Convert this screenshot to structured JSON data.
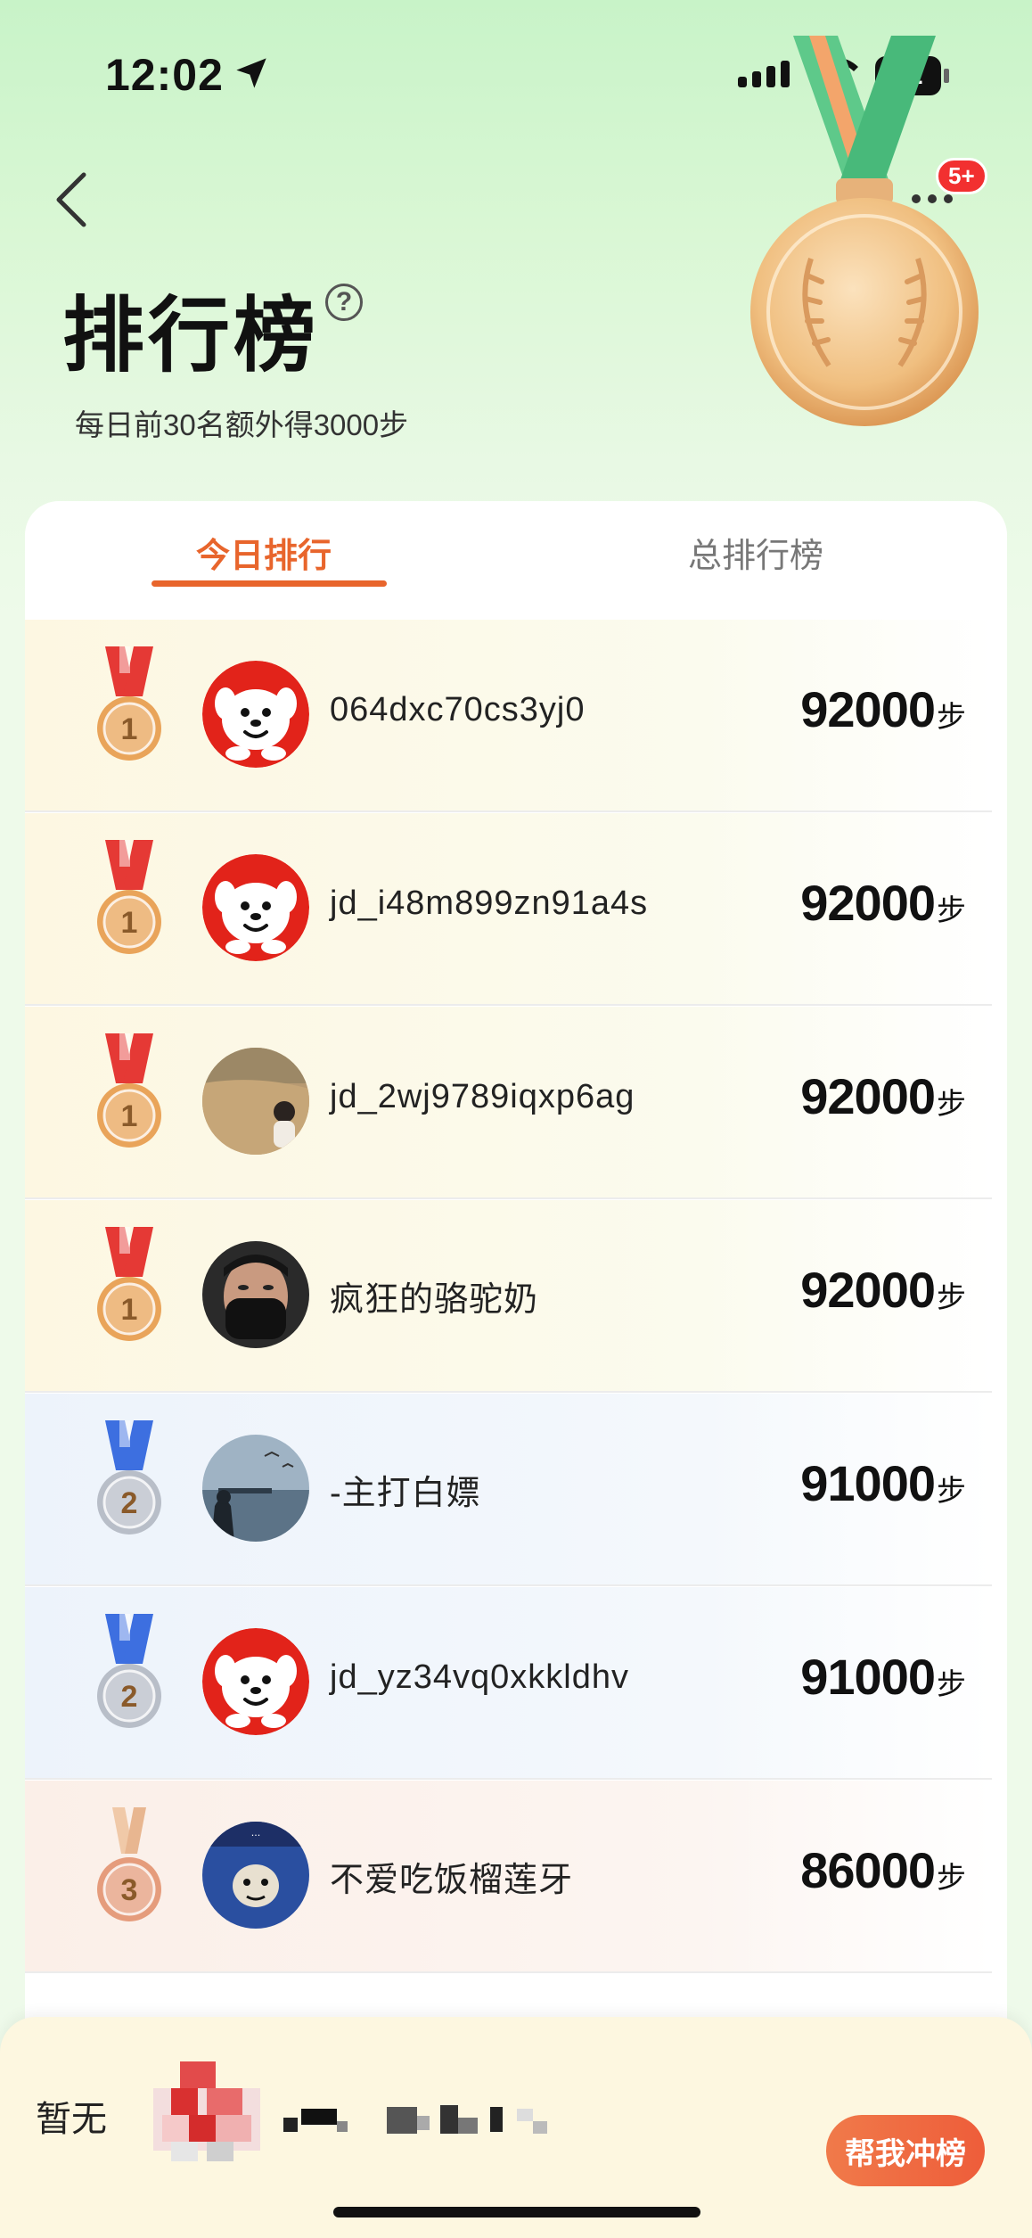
{
  "status_bar": {
    "time": "12:02",
    "battery": "92"
  },
  "header": {
    "title": "排行榜",
    "help": "?",
    "subtitle": "每日前30名额外得3000步",
    "more_badge": "5+"
  },
  "tabs": [
    {
      "label": "今日排行",
      "active": true
    },
    {
      "label": "总排行榜",
      "active": false
    }
  ],
  "leaderboard": [
    {
      "rank": "1",
      "medal": "gold",
      "avatar": "jd-dog-avatar",
      "name": "064dxc70cs3yj0",
      "steps": "92000",
      "unit": "步"
    },
    {
      "rank": "1",
      "medal": "gold",
      "avatar": "jd-dog-avatar",
      "name": "jd_i48m899zn91a4s",
      "steps": "92000",
      "unit": "步"
    },
    {
      "rank": "1",
      "medal": "gold",
      "avatar": "photo-avatar",
      "name": "jd_2wj9789iqxp6ag",
      "steps": "92000",
      "unit": "步"
    },
    {
      "rank": "1",
      "medal": "gold",
      "avatar": "masked-person-avatar",
      "name": "疯狂的骆驼奶",
      "steps": "92000",
      "unit": "步"
    },
    {
      "rank": "2",
      "medal": "silver",
      "avatar": "seaside-photo-avatar",
      "name": "-主打白嫖",
      "steps": "91000",
      "unit": "步"
    },
    {
      "rank": "2",
      "medal": "silver",
      "avatar": "jd-dog-avatar",
      "name": "jd_yz34vq0xkkldhv",
      "steps": "91000",
      "unit": "步"
    },
    {
      "rank": "3",
      "medal": "bronze",
      "avatar": "meme-avatar",
      "name": "不爱吃饭榴莲牙",
      "steps": "86000",
      "unit": "步"
    }
  ],
  "my_rank": {
    "label": "暂无",
    "button": "帮我冲榜"
  },
  "colors": {
    "accent": "#e8652c",
    "gold": "#e9a45a",
    "silver": "#b8bec8",
    "bronze": "#e59c7c",
    "ribbon_gold": "#e53935",
    "ribbon_silver": "#3d6fe0"
  }
}
